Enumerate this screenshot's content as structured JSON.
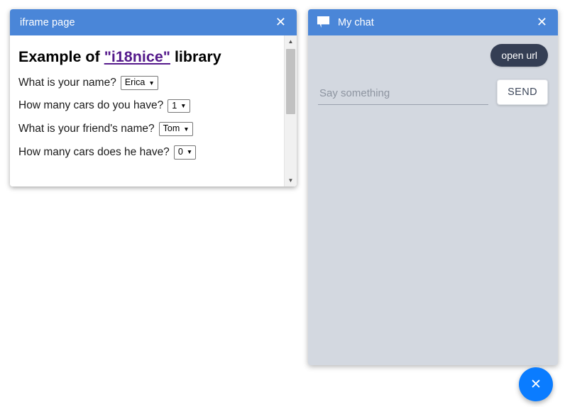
{
  "iframe_window": {
    "title": "iframe page",
    "close_label": "✕",
    "content": {
      "heading_prefix": "Example of ",
      "heading_link": "\"i18nice\"",
      "heading_suffix": " library",
      "questions": [
        {
          "label": "What is your name?",
          "value": "Erica",
          "caret": "▼"
        },
        {
          "label": "How many cars do you have?",
          "value": "1",
          "caret": "▼"
        },
        {
          "label": "What is your friend's name?",
          "value": "Tom",
          "caret": "▼"
        },
        {
          "label": "How many cars does he have?",
          "value": "0",
          "caret": "▼"
        }
      ]
    },
    "scrollbar": {
      "up_arrow": "▲",
      "down_arrow": "▼"
    }
  },
  "chat_window": {
    "icon_name": "chat-bubble-icon",
    "title": "My chat",
    "close_label": "✕",
    "messages": [
      {
        "text": "open url",
        "direction": "outgoing"
      }
    ],
    "input_placeholder": "Say something",
    "input_value": "",
    "send_label": "SEND"
  },
  "fab": {
    "icon": "✕",
    "name": "close-chat-fab"
  },
  "colors": {
    "header_blue": "#4a86d8",
    "chat_panel": "#d3d8e0",
    "bubble_dark": "#343e54",
    "fab_blue": "#0a7cff",
    "link_purple": "#551a8b"
  }
}
